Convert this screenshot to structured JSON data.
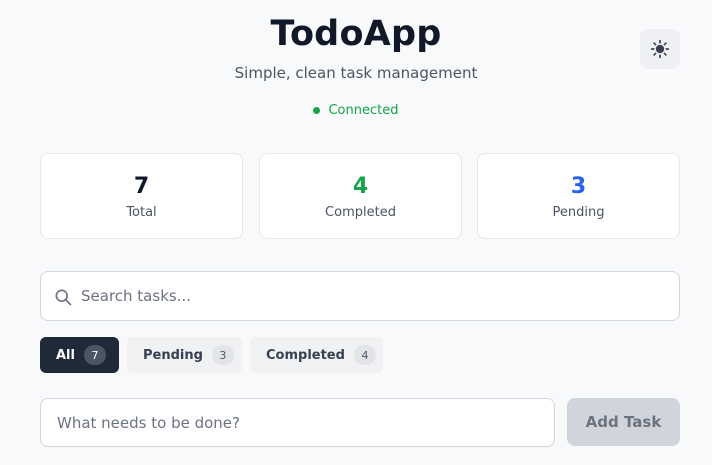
{
  "header": {
    "title": "TodoApp",
    "subtitle": "Simple, clean task management",
    "theme_toggle_icon": "sun-icon"
  },
  "status": {
    "text": "Connected",
    "color": "#16a34a"
  },
  "stats": [
    {
      "value": "7",
      "label": "Total",
      "color": "#111827"
    },
    {
      "value": "4",
      "label": "Completed",
      "color": "#16a34a"
    },
    {
      "value": "3",
      "label": "Pending",
      "color": "#2563eb"
    }
  ],
  "search": {
    "placeholder": "Search tasks...",
    "value": "",
    "icon": "search-icon"
  },
  "filters": [
    {
      "label": "All",
      "count": "7",
      "active": true
    },
    {
      "label": "Pending",
      "count": "3",
      "active": false
    },
    {
      "label": "Completed",
      "count": "4",
      "active": false
    }
  ],
  "new_task": {
    "placeholder": "What needs to be done?",
    "value": "",
    "button_label": "Add Task"
  },
  "colors": {
    "background": "#f8f9fb",
    "active_filter": "#1f2937",
    "button_disabled": "#d1d5db"
  }
}
